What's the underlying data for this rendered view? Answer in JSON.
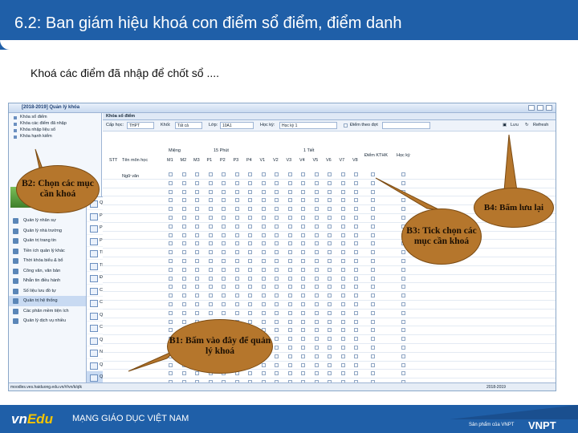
{
  "slide": {
    "title": "6.2:  Ban giám hiệu khoá con điểm sổ điểm, điểm danh",
    "subtitle": "Khoá các điểm đã nhập để chốt sổ ...."
  },
  "app": {
    "window_title": "[2018-2019] Quản lý khóa",
    "tree": [
      "Khóa sổ điểm",
      "Khóa các điểm đã nhập",
      "Khóa nhập liệu sổ",
      "Khóa hạnh kiểm"
    ],
    "menu": [
      {
        "label": "Quản lý nhân sự"
      },
      {
        "label": "Quản lý nhà trường"
      },
      {
        "label": "Quản trị trang tin"
      },
      {
        "label": "Tiền ích quản lý khác"
      },
      {
        "label": "Thời khóa biểu & bổ"
      },
      {
        "label": "Công văn, văn bản"
      },
      {
        "label": "Nhắn tin điều hành"
      },
      {
        "label": "Số liệu lưu đồ tự"
      },
      {
        "label": "Quản trị hệ thống"
      },
      {
        "label": "Các phân mềm tiện ích"
      },
      {
        "label": "Quản lý dịch vụ nhiều"
      }
    ],
    "submenu": [
      "Quản lý người",
      "Phân công giảng dạy",
      "Phân công chủ nhiệm",
      "Phân công quản sinh",
      "Thống kê nhập điểm",
      "Thống kê nhập điểm - Chi tiết",
      "Điểm tố phân tích bài giảng",
      "Cấu hình số cột điểm",
      "Cấu hình hệ thống",
      "Quản lý quyền đăng",
      "Chuyển đổi dữ liệu",
      "Quản lý số lượng xóa",
      "Nhật ký người sử dụng",
      "Quản lý CTP",
      "Quản lý khóa"
    ],
    "main_title": "Khóa sổ điểm",
    "filters": {
      "cap_hoc_label": "Cấp học:",
      "cap_hoc_value": "THPT",
      "khoi_label": "Khối:",
      "khoi_value": "Tất cả",
      "lop_label": "Lớp:",
      "lop_value": "10A1",
      "hoc_ky_label": "Học kỳ:",
      "hoc_ky_value": "Học kỳ 1",
      "diem_theo_dot": "Điểm theo đợt",
      "save_label": "Lưu",
      "refresh_label": "Refresh"
    },
    "grid_headers": {
      "stt": "STT",
      "ten_mon": "Tên môn học",
      "mieng": "Miệng",
      "mot_lam_phut": "15 Phút",
      "mot_tiet": "1 Tiết",
      "diem_ktkh": "Điểm KTHK",
      "hoc_ky": "Học kỳ",
      "first_subject": "Ngữ văn",
      "cols": [
        "M1",
        "M2",
        "M3",
        "P1",
        "P2",
        "P3",
        "P4",
        "V1",
        "V2",
        "V3",
        "V4",
        "V5",
        "V6",
        "V7",
        "V8"
      ]
    },
    "status_bar": "moodles.ves.haiduong.edu.vn/#/vn/k/qlk",
    "status_right": "2018-2019"
  },
  "callouts": {
    "b1": "B1: Bấm vào đây để quản lý khoá",
    "b2": "B2: Chọn các mục cần khoá",
    "b3": "B3: Tick chọn các mục cần khoá",
    "b4": "B4: Bấm lưu lại"
  },
  "footer": {
    "logo_vn": "vn",
    "logo_edu": "Edu",
    "slogan": "MẠNG GIÁO DỤC VIỆT NAM",
    "product_of": "Sản phẩm của VNPT",
    "vnpt": "VNPT"
  }
}
